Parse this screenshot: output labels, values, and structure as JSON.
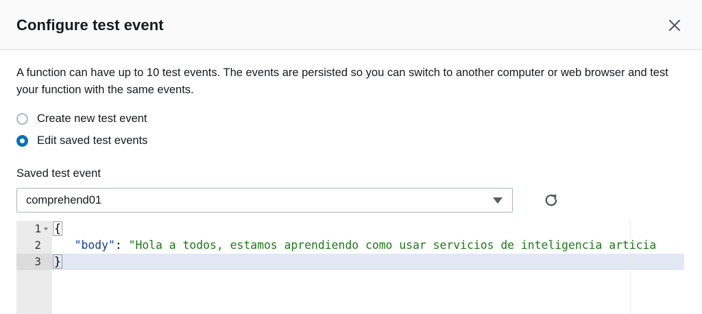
{
  "dialog": {
    "title": "Configure test event",
    "close_icon": "close-icon"
  },
  "description": "A function can have up to 10 test events. The events are persisted so you can switch to another computer or web browser and test your function with the same events.",
  "options": [
    {
      "label": "Create new test event",
      "checked": false
    },
    {
      "label": "Edit saved test events",
      "checked": true
    }
  ],
  "saved_event": {
    "label": "Saved test event",
    "selected": "comprehend01",
    "caret_icon": "caret-down-icon",
    "refresh_icon": "refresh-icon"
  },
  "editor": {
    "lines": [
      {
        "number": "1",
        "text": "{"
      },
      {
        "number": "2",
        "key": "\"body\"",
        "sep": ": ",
        "value": "\"Hola a todos, estamos aprendiendo como usar servicios de inteligencia articia"
      },
      {
        "number": "3",
        "text": "}"
      }
    ],
    "colors": {
      "key": "#0d3ea0",
      "string": "#1a7a15",
      "active_line": "#e2e8f3",
      "gutter": "#ebebeb"
    }
  },
  "colors": {
    "accent": "#0073bb",
    "text": "#16191f",
    "border": "#aab7b8"
  }
}
